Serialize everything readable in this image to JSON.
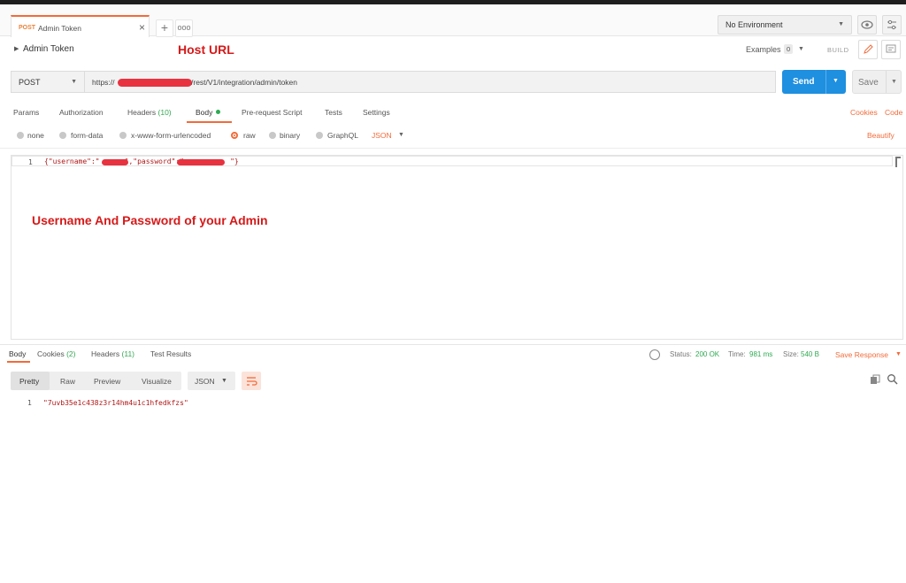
{
  "tabs": {
    "active": {
      "method": "POST",
      "name": "Admin Token"
    },
    "add_label": "+",
    "more_label": "ooo"
  },
  "environment": {
    "selected": "No Environment"
  },
  "request": {
    "name": "Admin Token",
    "examples_label": "Examples",
    "examples_count": "0",
    "build_label": "BUILD",
    "method": "POST",
    "url_prefix": "https://",
    "url_suffix": "/rest/V1/integration/admin/token",
    "send_label": "Send",
    "save_label": "Save"
  },
  "annotations": {
    "host_url": "Host URL",
    "credentials": "Username And Password of your Admin"
  },
  "request_tabs": {
    "params": "Params",
    "authorization": "Authorization",
    "headers": "Headers",
    "headers_count": "(10)",
    "body": "Body",
    "prerequest": "Pre-request Script",
    "tests": "Tests",
    "settings": "Settings",
    "cookies": "Cookies",
    "code": "Code"
  },
  "body_modes": {
    "none": "none",
    "form_data": "form-data",
    "urlencoded": "x-www-form-urlencoded",
    "raw": "raw",
    "binary": "binary",
    "graphql": "GraphQL",
    "type": "JSON",
    "beautify": "Beautify",
    "selected": "raw"
  },
  "editor": {
    "line_number": "1",
    "part1": "{\"username\":\"",
    "part2": "\",\"password\":\"",
    "part3": "\"}"
  },
  "response_tabs": {
    "body": "Body",
    "cookies": "Cookies",
    "cookies_count": "(2)",
    "headers": "Headers",
    "headers_count": "(11)",
    "test_results": "Test Results"
  },
  "response_status": {
    "status_label": "Status:",
    "status_value": "200 OK",
    "time_label": "Time:",
    "time_value": "981 ms",
    "size_label": "Size:",
    "size_value": "540 B",
    "save_response": "Save Response"
  },
  "response_view": {
    "pretty": "Pretty",
    "raw": "Raw",
    "preview": "Preview",
    "visualize": "Visualize",
    "type": "JSON"
  },
  "response_body": {
    "line_number": "1",
    "content": "\"7uvb35e1c438z3r14hm4u1c1hfedkfzs\""
  },
  "colors": {
    "accent": "#f26b3a",
    "send": "#1f8fe0",
    "success": "#2eaa52",
    "annotation": "#d61919",
    "redaction": "#e8323f"
  }
}
